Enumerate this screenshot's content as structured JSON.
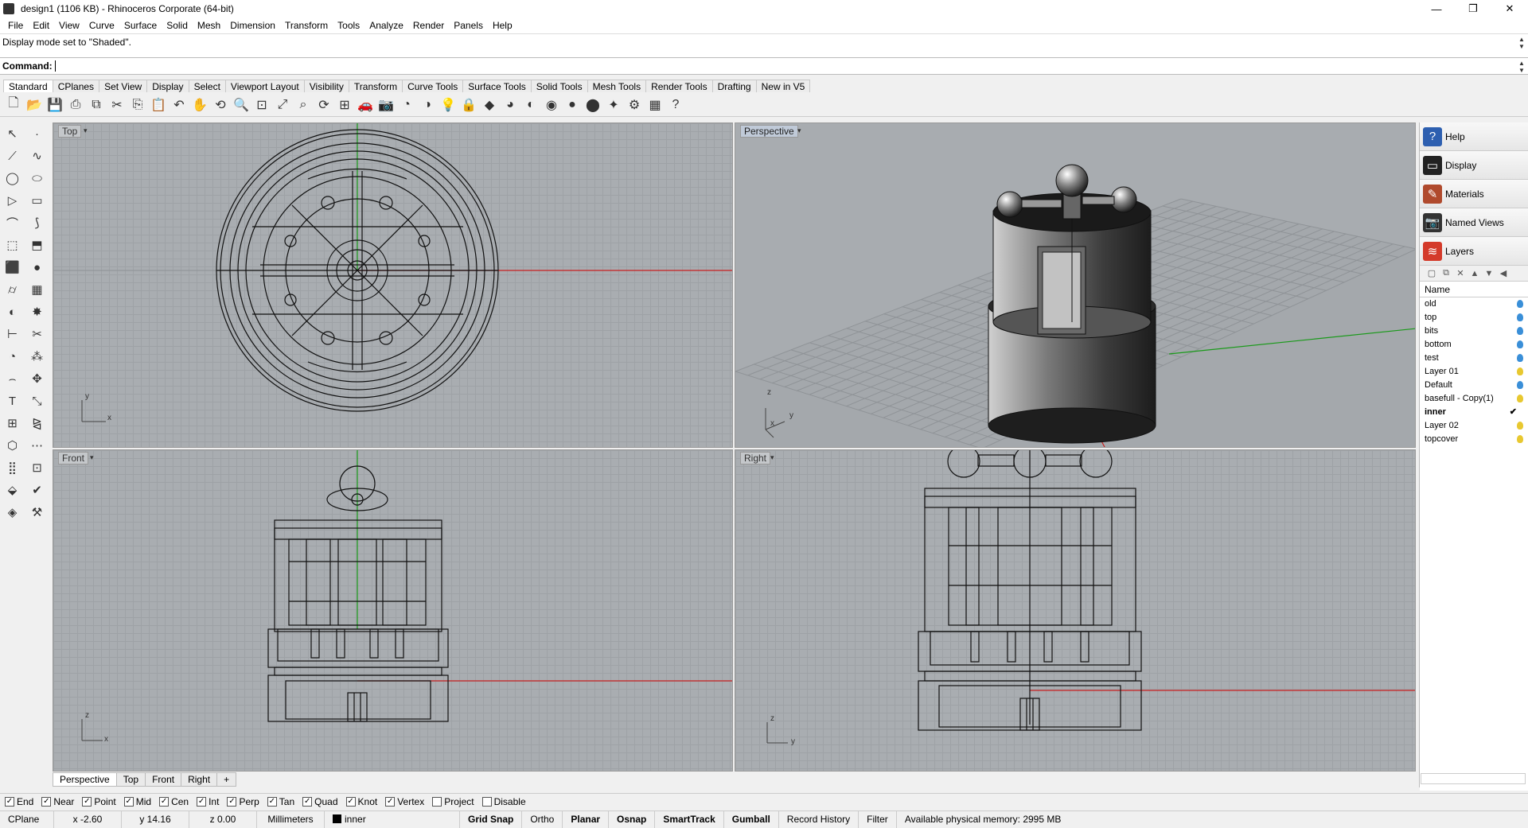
{
  "window": {
    "title": "design1 (1106 KB) - Rhinoceros Corporate (64-bit)",
    "minimize": "—",
    "maximize": "❐",
    "close": "✕"
  },
  "menu": [
    "File",
    "Edit",
    "View",
    "Curve",
    "Surface",
    "Solid",
    "Mesh",
    "Dimension",
    "Transform",
    "Tools",
    "Analyze",
    "Render",
    "Panels",
    "Help"
  ],
  "history": "Display mode set to \"Shaded\".",
  "command": {
    "label": "Command:",
    "value": ""
  },
  "toolbar_tabs": [
    "Standard",
    "CPlanes",
    "Set View",
    "Display",
    "Select",
    "Viewport Layout",
    "Visibility",
    "Transform",
    "Curve Tools",
    "Surface Tools",
    "Solid Tools",
    "Mesh Tools",
    "Render Tools",
    "Drafting",
    "New in V5"
  ],
  "toolbar_icons": [
    "new-icon",
    "open-icon",
    "save-icon",
    "print-icon",
    "import-icon",
    "cut-icon",
    "copy-icon",
    "paste-icon",
    "undo-icon",
    "pan-icon",
    "rotate-icon",
    "zoom-icon",
    "zoom-window-icon",
    "zoom-extents-icon",
    "zoom-selected-icon",
    "view-rotate-icon",
    "four-view-icon",
    "car-icon",
    "camera-icon",
    "properties-icon",
    "hide-icon",
    "light-icon",
    "lock-icon",
    "material-icon",
    "color-wheel-icon",
    "shade-icon",
    "render-icon",
    "raytrace-icon",
    "sphere-icon",
    "wand-icon",
    "gears-icon",
    "grid-icon",
    "help-icon"
  ],
  "viewports": {
    "top": {
      "label": "Top",
      "axis_y": "y",
      "axis_x": "x"
    },
    "perspective": {
      "label": "Perspective",
      "axis_z": "z",
      "axis_y": "y",
      "axis_x": "x"
    },
    "front": {
      "label": "Front",
      "axis_z": "z",
      "axis_x": "x"
    },
    "right": {
      "label": "Right",
      "axis_z": "z",
      "axis_y": "y"
    }
  },
  "panels": [
    {
      "label": "Help",
      "icon": "help-icon",
      "color": "#2d5fb0"
    },
    {
      "label": "Display",
      "icon": "monitor-icon",
      "color": "#222222"
    },
    {
      "label": "Materials",
      "icon": "brush-icon",
      "color": "#b04a2d"
    },
    {
      "label": "Named Views",
      "icon": "camera-icon",
      "color": "#333333"
    },
    {
      "label": "Layers",
      "icon": "layers-icon",
      "color": "#d43a2a"
    }
  ],
  "layers": {
    "header": "Name",
    "items": [
      {
        "name": "old",
        "bulb": "#3a8fd8",
        "current": false
      },
      {
        "name": "top",
        "bulb": "#3a8fd8",
        "current": false
      },
      {
        "name": "bits",
        "bulb": "#3a8fd8",
        "current": false
      },
      {
        "name": "bottom",
        "bulb": "#3a8fd8",
        "current": false
      },
      {
        "name": "test",
        "bulb": "#3a8fd8",
        "current": false
      },
      {
        "name": "Layer 01",
        "bulb": "#e8c830",
        "current": false
      },
      {
        "name": "Default",
        "bulb": "#3a8fd8",
        "current": false
      },
      {
        "name": "basefull - Copy(1)",
        "bulb": "#e8c830",
        "current": false
      },
      {
        "name": "inner",
        "bulb": "",
        "current": true,
        "mark": "✔"
      },
      {
        "name": "Layer 02",
        "bulb": "#e8c830",
        "current": false
      },
      {
        "name": "topcover",
        "bulb": "#e8c830",
        "current": false
      }
    ]
  },
  "viewport_tabs": [
    "Perspective",
    "Top",
    "Front",
    "Right",
    "+"
  ],
  "osnaps": [
    {
      "label": "End",
      "checked": true
    },
    {
      "label": "Near",
      "checked": true
    },
    {
      "label": "Point",
      "checked": true
    },
    {
      "label": "Mid",
      "checked": true
    },
    {
      "label": "Cen",
      "checked": true
    },
    {
      "label": "Int",
      "checked": true
    },
    {
      "label": "Perp",
      "checked": true
    },
    {
      "label": "Tan",
      "checked": true
    },
    {
      "label": "Quad",
      "checked": true
    },
    {
      "label": "Knot",
      "checked": true
    },
    {
      "label": "Vertex",
      "checked": true
    },
    {
      "label": "Project",
      "checked": false
    },
    {
      "label": "Disable",
      "checked": false
    }
  ],
  "status": {
    "cplane": "CPlane",
    "x": "x -2.60",
    "y": "y 14.16",
    "z": "z 0.00",
    "units": "Millimeters",
    "layer": "inner",
    "grid_snap": "Grid Snap",
    "ortho": "Ortho",
    "planar": "Planar",
    "osnap": "Osnap",
    "smarttrack": "SmartTrack",
    "gumball": "Gumball",
    "record_history": "Record History",
    "filter": "Filter",
    "memory": "Available physical memory: 2995 MB"
  }
}
